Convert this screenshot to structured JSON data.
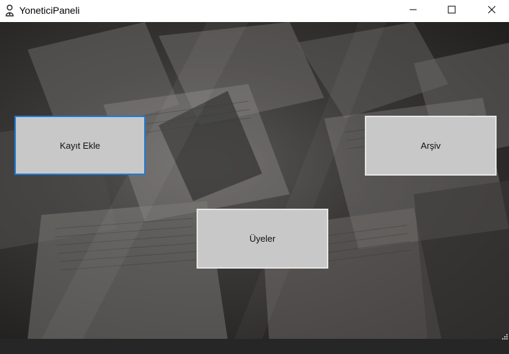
{
  "window": {
    "title": "YoneticiPaneli",
    "icon": "person-icon",
    "controls": {
      "minimize": "minimize-icon",
      "maximize": "maximize-icon",
      "close": "close-icon"
    }
  },
  "buttons": {
    "kayit_ekle": "Kayıt Ekle",
    "arsiv": "Arşiv",
    "uyeler": "Üyeler"
  },
  "colors": {
    "button_face": "#c8c8c8",
    "focus_border": "#1e7bd9",
    "titlebar": "#ffffff"
  }
}
